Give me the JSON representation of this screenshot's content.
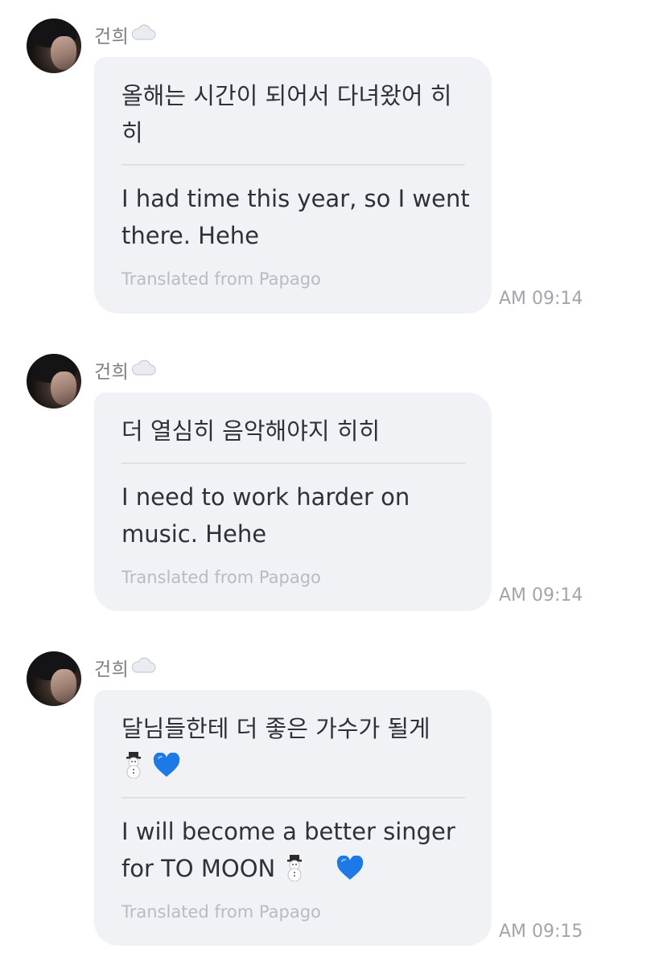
{
  "messages": [
    {
      "sender": "건희",
      "original": "올해는 시간이 되어서 다녀왔어 히히",
      "translation": "I had time this year, so I went there. Hehe",
      "credit": "Translated from Papago",
      "time": "AM 09:14"
    },
    {
      "sender": "건희",
      "original": "더 열심히 음악해야지 히히",
      "translation": "I need to work harder on music. Hehe",
      "credit": "Translated from Papago",
      "time": "AM 09:14"
    },
    {
      "sender": "건희",
      "original": "달님들한테 더 좋은 가수가 될게",
      "translation": "I will become a better singer for TO MOON",
      "credit": "Translated from Papago",
      "time": "AM 09:15"
    }
  ],
  "icons": {
    "cloud": "cloud-icon",
    "snowman": "snowman-icon",
    "heart": "blue-heart-icon"
  },
  "colors": {
    "bubble": "#f1f2f5",
    "heart": "#1c79e6"
  }
}
